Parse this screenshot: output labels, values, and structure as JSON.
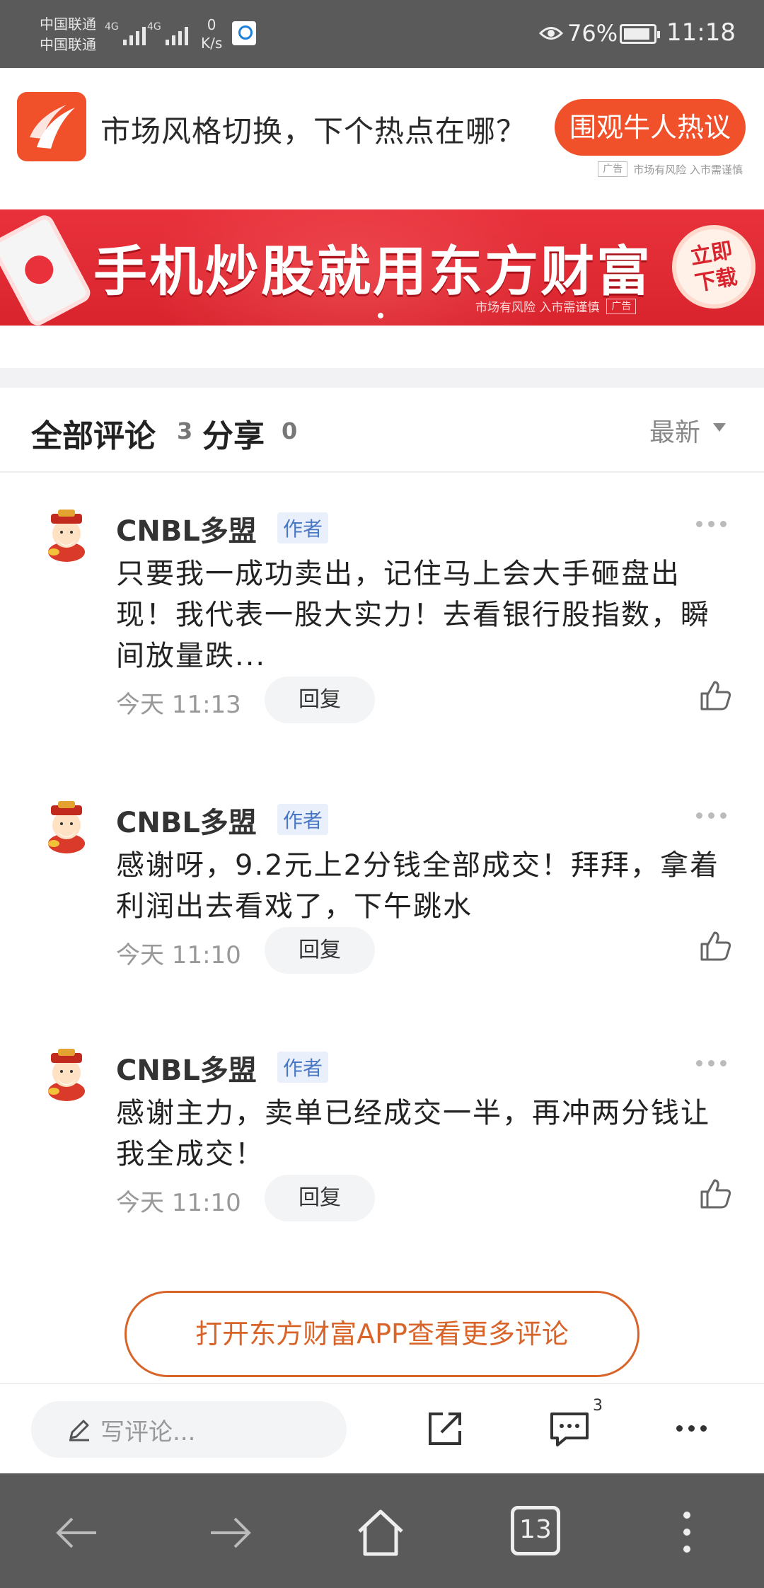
{
  "status_bar": {
    "carrier1": "中国联通",
    "carrier2": "中国联通",
    "net1": "4G",
    "net2": "4G",
    "speed_value": "0",
    "speed_unit": "K/s",
    "battery": "76%",
    "time": "11:18"
  },
  "top_ad": {
    "headline": "市场风格切换，下个热点在哪？",
    "cta": "围观牛人热议",
    "tag": "广告",
    "risk_note": "市场有风险 入市需谨慎"
  },
  "banner": {
    "title": "手机炒股就用东方财富",
    "cta_line1": "立即",
    "cta_line2": "下载",
    "risk_note": "市场有风险 入市需谨慎",
    "tag": "广告"
  },
  "comments_header": {
    "all_label": "全部评论",
    "all_count": "3",
    "share_label": "分享",
    "share_count": "0",
    "sort": "最新"
  },
  "comments": [
    {
      "author": "CNBL多盟",
      "badge": "作者",
      "text": "只要我一成功卖出，记住马上会大手砸盘出现！我代表一股大实力！去看银行股指数，瞬间放量跌...",
      "time": "今天 11:13",
      "reply": "回复"
    },
    {
      "author": "CNBL多盟",
      "badge": "作者",
      "text": "感谢呀，9.2元上2分钱全部成交！拜拜，拿着利润出去看戏了，下午跳水",
      "time": "今天 11:10",
      "reply": "回复"
    },
    {
      "author": "CNBL多盟",
      "badge": "作者",
      "text": "感谢主力，卖单已经成交一半，再冲两分钱让我全成交！",
      "time": "今天 11:10",
      "reply": "回复"
    }
  ],
  "open_app": "打开东方财富APP查看更多评论",
  "toolbar": {
    "write_placeholder": "写评论...",
    "comment_count": "3"
  },
  "navbar": {
    "tab_count": "13"
  },
  "icons": {
    "back": "arrow-left-icon",
    "forward": "arrow-right-icon",
    "home": "home-icon",
    "tabs": "tabs-icon",
    "menu": "more-vertical-icon"
  },
  "colors": {
    "accent_orange": "#f0502a",
    "banner_red": "#e8313b",
    "link_orange": "#d9642a",
    "badge_blue": "#4a78c4"
  }
}
